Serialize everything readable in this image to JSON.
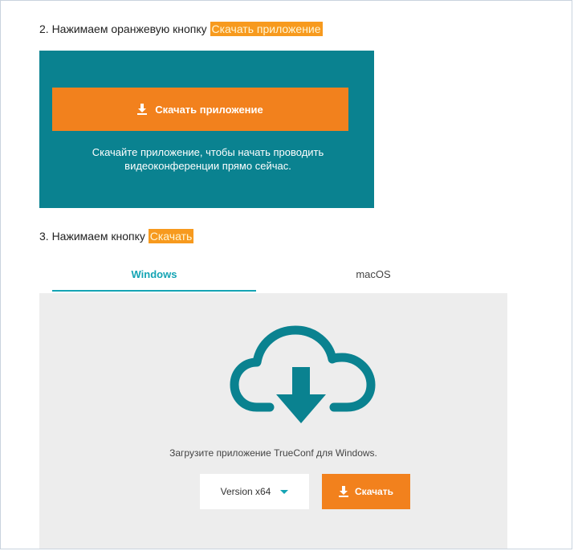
{
  "step2": {
    "text": "2. Нажимаем оранжевую кнопку ",
    "highlight": "Скачать приложение"
  },
  "teal_block": {
    "button_label": "Скачать приложение",
    "caption": "Скачайте приложение, чтобы начать проводить видеоконференции прямо сейчас."
  },
  "step3": {
    "text": "3. Нажимаем кнопку ",
    "highlight": "Скачать"
  },
  "tabs": [
    {
      "label": "Windows",
      "active": true
    },
    {
      "label": "macOS",
      "active": false
    }
  ],
  "download_panel": {
    "icon": "cloud-download-icon",
    "caption": "Загрузите приложение TrueConf для Windows.",
    "version_selected": "Version x64",
    "download_label": "Скачать"
  },
  "colors": {
    "teal": "#0a8290",
    "orange": "#f2811d",
    "accent": "#15a4b4",
    "panel": "#ededed"
  }
}
